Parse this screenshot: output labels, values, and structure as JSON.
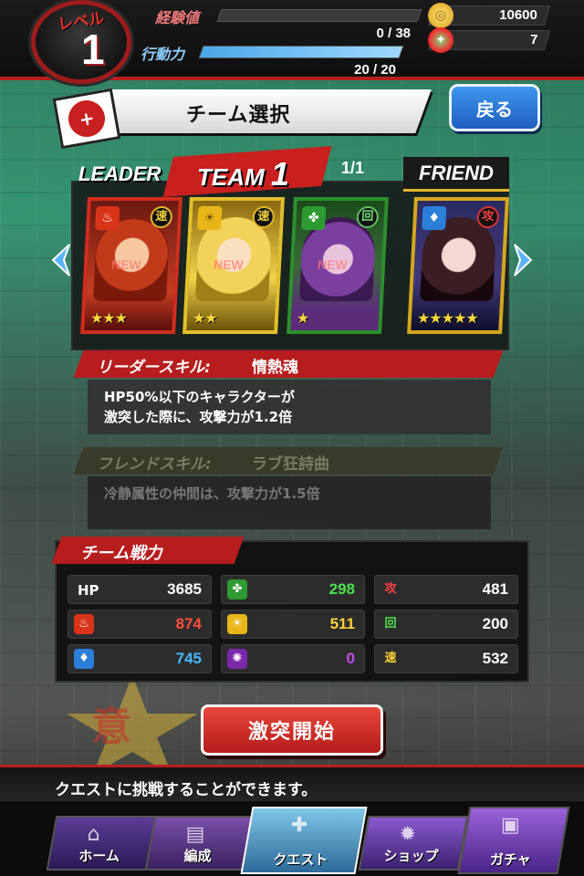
{
  "status": {
    "level_label": "レベル",
    "level": "1",
    "exp_label": "経験値",
    "exp_value": "0 / 38",
    "exp_fill": 0.0,
    "ap_label": "行動力",
    "ap_value": "20 / 20",
    "ap_fill": 1.0,
    "coins": "10600",
    "gems": "7"
  },
  "header": {
    "title": "チーム選択",
    "back_label": "戻る"
  },
  "team": {
    "leader_label": "LEADER",
    "team_label": "TEAM",
    "team_number": "1",
    "counter": "1/1",
    "friend_label": "FRIEND",
    "new_tag": "NEW",
    "cards": [
      {
        "attribute_icon": "fire-icon",
        "type": "速",
        "stars": "★★★"
      },
      {
        "attribute_icon": "light-icon",
        "type": "速",
        "stars": "★★"
      },
      {
        "attribute_icon": "wood-icon",
        "type": "回",
        "stars": "★"
      },
      {
        "attribute_icon": "water-icon",
        "type": "攻",
        "stars": "★★★★★"
      }
    ]
  },
  "leader_skill": {
    "title": "リーダースキル:",
    "name": "情熱魂",
    "line1": "HP50%以下のキャラクターが",
    "line2": "激突した際に、攻撃力が1.2倍"
  },
  "friend_skill": {
    "title": "フレンドスキル:",
    "name": "ラブ狂詩曲",
    "line1": "冷静属性の仲間は、攻撃力が1.5倍"
  },
  "power": {
    "title": "チーム戦力",
    "hp_label": "HP",
    "hp": "3685",
    "fire": "874",
    "water": "745",
    "wood": "298",
    "light": "511",
    "dark": "0",
    "attack_label": "攻",
    "attack": "481",
    "heal_label": "回",
    "heal": "200",
    "speed_label": "速",
    "speed": "532"
  },
  "colors": {
    "fire": "#ff4d3a",
    "water": "#46b8ff",
    "wood": "#4fe04f",
    "light": "#ffd23a",
    "dark": "#c14ae8"
  },
  "start_button": "激突開始",
  "message": "クエストに挑戦することができます。",
  "nav": {
    "home": "ホーム",
    "team": "編成",
    "quest": "クエスト",
    "shop": "ショップ",
    "gacha": "ガチャ"
  }
}
